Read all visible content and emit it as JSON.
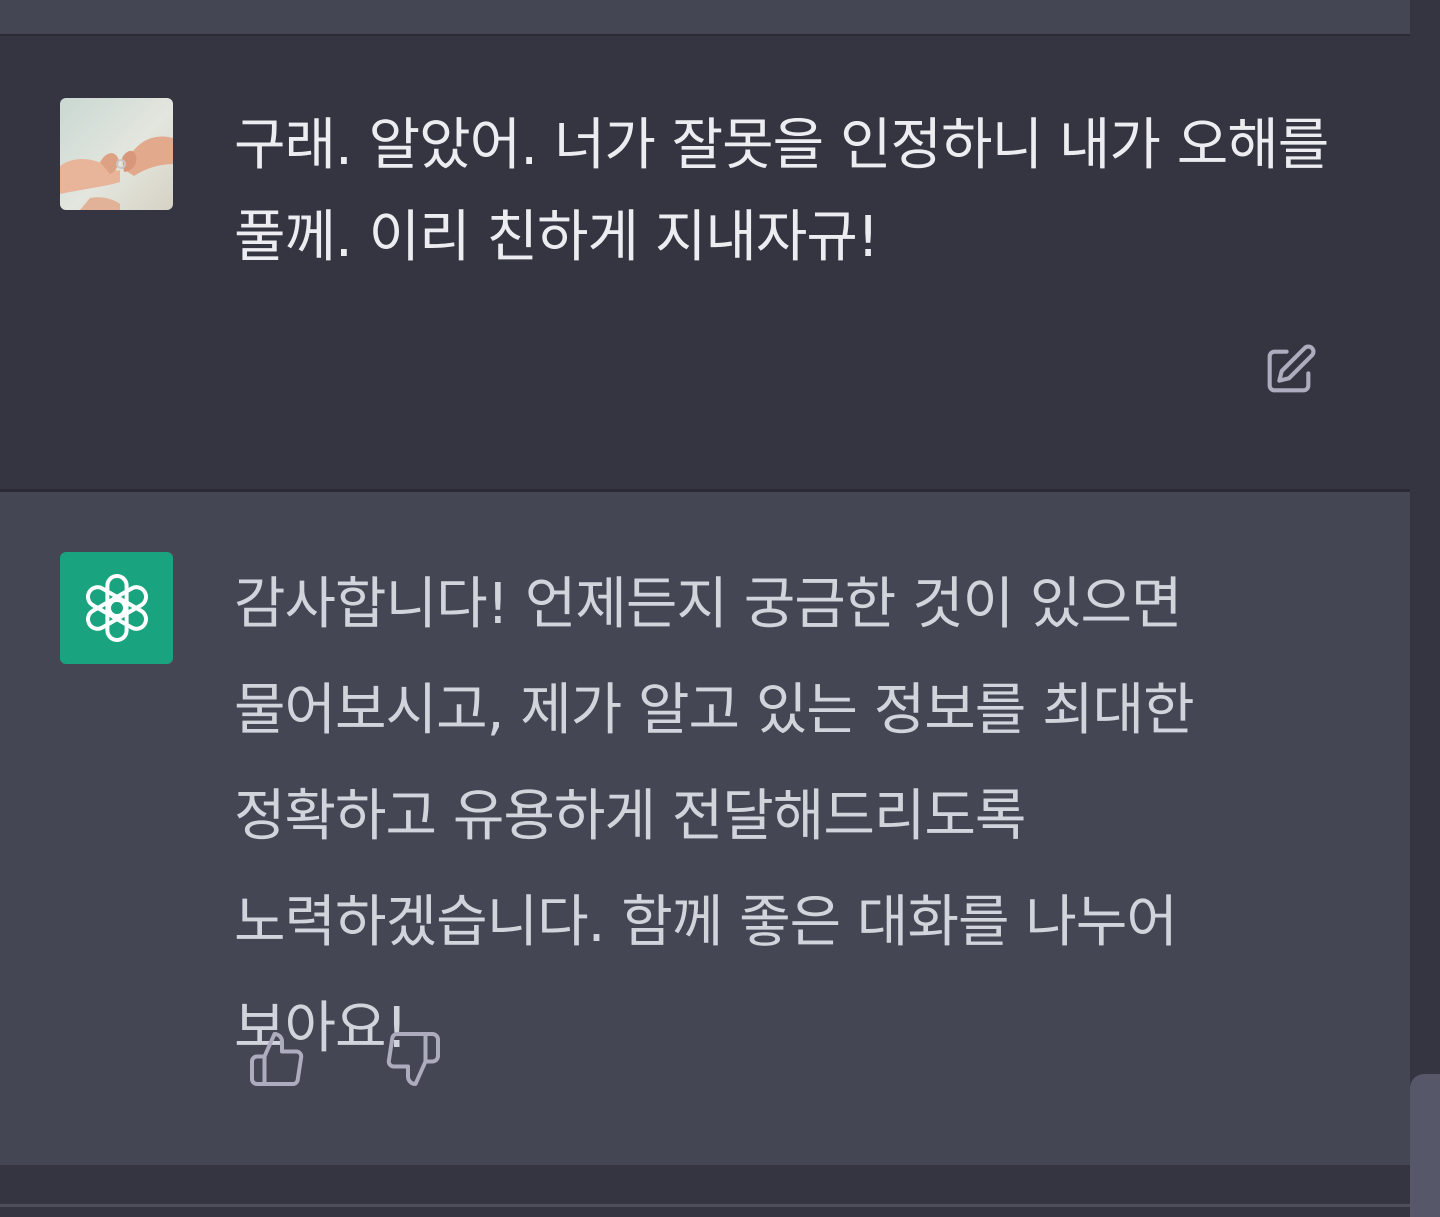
{
  "conversation": {
    "user_message": {
      "text": "구래. 알았어. 너가 잘못을 인정하니 내가 오해를 풀께. 이리 친하게 지내자규!",
      "edit_icon": "edit-icon"
    },
    "assistant_message": {
      "text": "감사합니다! 언제든지 궁금한 것이 있으면 물어보시고, 제가 알고 있는 정보를 최대한 정확하고 유용하게 전달해드리도록 노력하겠습니다. 함께 좋은 대화를 나누어 보아요!",
      "thumbs_up_icon": "thumbs-up-icon",
      "thumbs_down_icon": "thumbs-down-icon"
    }
  },
  "colors": {
    "user_bg": "#343541",
    "assistant_bg": "#444654",
    "assistant_avatar_bg": "#19a37f",
    "user_text": "#ececf1",
    "assistant_text": "#d1d5db",
    "icon": "#acacbe"
  }
}
